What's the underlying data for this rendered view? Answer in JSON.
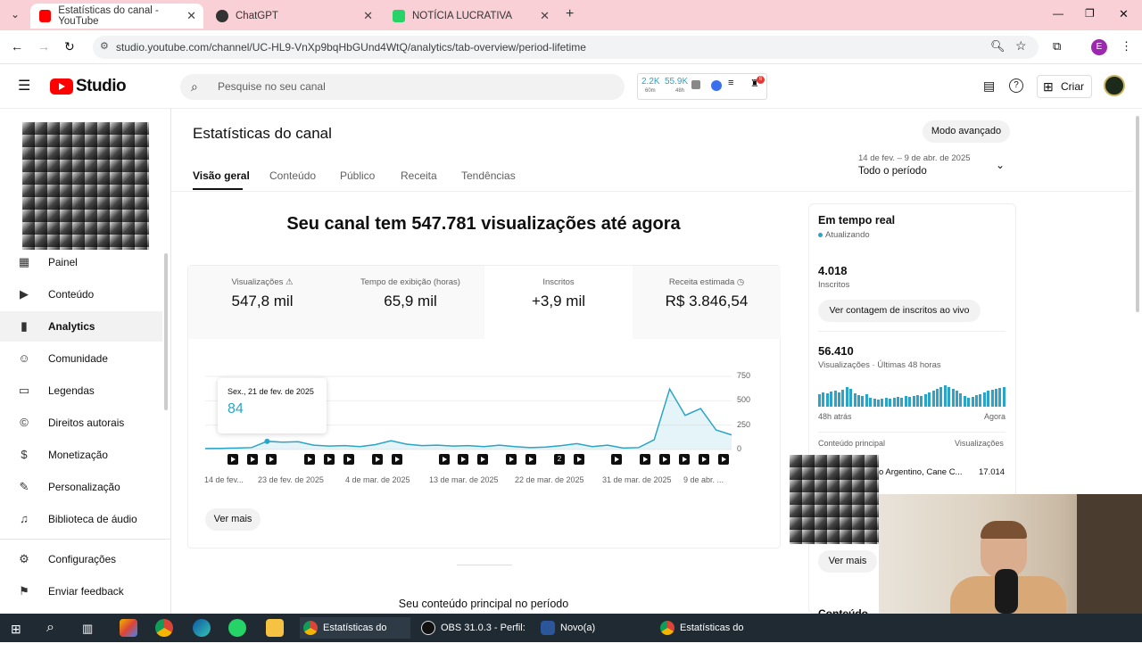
{
  "browser": {
    "tabs": [
      {
        "label": "Estatísticas do canal - YouTube",
        "color": "#ff0000"
      },
      {
        "label": "ChatGPT",
        "color": "#333333"
      },
      {
        "label": "NOTÍCIA LUCRATIVA",
        "color": "#25d366"
      }
    ],
    "url": "studio.youtube.com/channel/UC-HL9-VnXp9bqHbGUnd4WtQ/analytics/tab-overview/period-lifetime",
    "profile_letter": "E"
  },
  "header": {
    "logo": "Studio",
    "search_placeholder": "Pesquise no seu canal",
    "ext_stats": {
      "v1": "2.2K",
      "s1": "60m",
      "v2": "55.9K",
      "s2": "48h",
      "badge": "6"
    },
    "create_label": "Criar"
  },
  "sidebar": {
    "items": [
      {
        "label": "Painel",
        "icon": "dashboard-icon",
        "glyph": "▦"
      },
      {
        "label": "Conteúdo",
        "icon": "content-icon",
        "glyph": "▶"
      },
      {
        "label": "Analytics",
        "icon": "analytics-icon",
        "glyph": "▮"
      },
      {
        "label": "Comunidade",
        "icon": "community-icon",
        "glyph": "☺"
      },
      {
        "label": "Legendas",
        "icon": "subtitles-icon",
        "glyph": "▭"
      },
      {
        "label": "Direitos autorais",
        "icon": "copyright-icon",
        "glyph": "©"
      },
      {
        "label": "Monetização",
        "icon": "monetization-icon",
        "glyph": "$"
      },
      {
        "label": "Personalização",
        "icon": "customization-icon",
        "glyph": "✎"
      },
      {
        "label": "Biblioteca de áudio",
        "icon": "audio-library-icon",
        "glyph": "♫"
      }
    ],
    "settings": "Configurações",
    "feedback": "Enviar feedback"
  },
  "main": {
    "title": "Estatísticas do canal",
    "advanced_mode": "Modo avançado",
    "tabs": [
      "Visão geral",
      "Conteúdo",
      "Público",
      "Receita",
      "Tendências"
    ],
    "period_range": "14 de fev. – 9 de abr. de 2025",
    "period_label": "Todo o período",
    "headline": "Seu canal tem 547.781 visualizações até agora",
    "kpis": [
      {
        "label": "Visualizações",
        "value": "547,8 mil"
      },
      {
        "label": "Tempo de exibição (horas)",
        "value": "65,9 mil"
      },
      {
        "label": "Inscritos",
        "value": "+3,9 mil"
      },
      {
        "label": "Receita estimada",
        "value": "R$ 3.846,54"
      }
    ],
    "tooltip": {
      "date": "Sex., 21 de fev. de 2025",
      "value": "84"
    },
    "see_more": "Ver mais",
    "top_content_title": "Seu conteúdo principal no período"
  },
  "chart_data": {
    "type": "line",
    "x_tick_labels": [
      "14 de fev...",
      "23 de fev. de 2025",
      "4 de mar. de 2025",
      "13 de mar. de 2025",
      "22 de mar. de 2025",
      "31 de mar. de 2025",
      "9 de abr. ..."
    ],
    "y_ticks": [
      0,
      250,
      500,
      750
    ],
    "ylim": [
      0,
      750
    ],
    "series": [
      {
        "values": [
          10,
          12,
          15,
          20,
          84,
          75,
          80,
          45,
          35,
          40,
          30,
          50,
          90,
          55,
          40,
          45,
          35,
          40,
          30,
          45,
          30,
          20,
          25,
          40,
          60,
          30,
          45,
          15,
          20,
          100,
          620,
          350,
          420,
          200,
          150
        ]
      }
    ],
    "annotation_marker": "2"
  },
  "realtime": {
    "title": "Em tempo real",
    "status": "Atualizando",
    "subs_value": "4.018",
    "subs_label": "Inscritos",
    "live_count_btn": "Ver contagem de inscritos ao vivo",
    "views_value": "56.410",
    "views_label": "Visualizações · Últimas 48 horas",
    "left_axis": "48h atrás",
    "right_axis": "Agora",
    "top_content_label": "Conteúdo principal",
    "top_views_label": "Visualizações",
    "top_item_title": "o Argentino, Cane C...",
    "top_item_views": "17.014",
    "see_more": "Ver mais",
    "cut_heading": "Conteúdo"
  },
  "taskbar": {
    "items": [
      "Estatísticas do cana...",
      "OBS 31.0.3 - Perfil: ...",
      "Novo(a) Document...",
      "Estatísticas do cana..."
    ]
  }
}
